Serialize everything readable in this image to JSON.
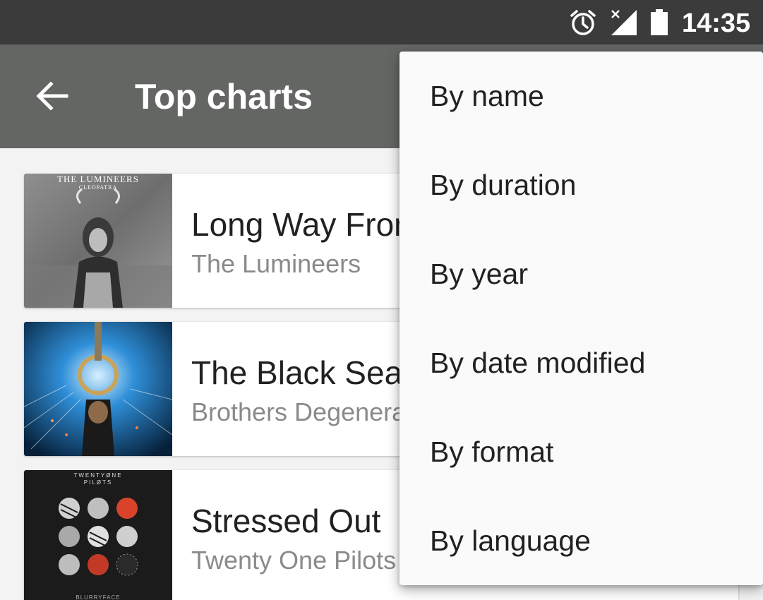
{
  "status_bar": {
    "time": "14:35",
    "icons": [
      "alarm-icon",
      "signal-icon",
      "battery-icon"
    ]
  },
  "toolbar": {
    "back_icon": "arrow-back-icon",
    "title": "Top charts"
  },
  "songs": [
    {
      "title": "Long Way From Home",
      "artist": "The Lumineers",
      "album_art_text": "THE LUMINEERS",
      "album_art_subtext": "CLEOPATRA"
    },
    {
      "title": "The Black Sea",
      "artist": "Brothers Degeneration",
      "album_art_text": "",
      "album_art_subtext": ""
    },
    {
      "title": "Stressed Out",
      "artist": "Twenty One Pilots",
      "album_art_text": "TWENTYØNE PILØTS",
      "album_art_subtext": "BLURRYFACE"
    }
  ],
  "sort_menu": {
    "items": [
      {
        "label": "By name"
      },
      {
        "label": "By duration"
      },
      {
        "label": "By year"
      },
      {
        "label": "By date modified"
      },
      {
        "label": "By format"
      },
      {
        "label": "By language"
      }
    ]
  },
  "colors": {
    "status_bar": "#3b3b3b",
    "toolbar": "#646664",
    "background": "#f3f3f3",
    "menu_background": "#fafafa",
    "primary_text": "#212121",
    "secondary_text": "#8a8a8a"
  }
}
